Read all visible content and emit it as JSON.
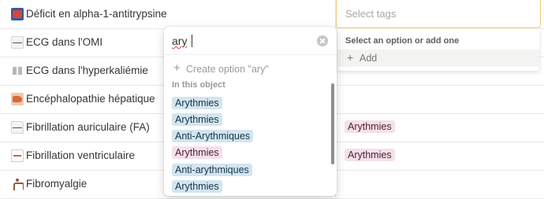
{
  "rows": [
    {
      "label": "Déficit en alpha-1-antitrypsine",
      "icon": "book-icon"
    },
    {
      "label": "ECG dans l'OMI",
      "icon": "ecg-icon"
    },
    {
      "label": "ECG dans l'hyperkaliémie",
      "icon": "ecg-pair-icon"
    },
    {
      "label": "Encéphalopathie hépatique",
      "icon": "liver-icon"
    },
    {
      "label": "Fibrillation auriculaire (FA)",
      "icon": "ecg-strip-icon",
      "tag": "Arythmies"
    },
    {
      "label": "Fibrillation ventriculaire",
      "icon": "ecg-grid-icon",
      "tag": "Arythmies"
    },
    {
      "label": "Fibromyalgie",
      "icon": "figure-icon"
    }
  ],
  "tags_cell": {
    "placeholder": "Select tags"
  },
  "option_menu": {
    "header": "Select an option or add one",
    "add_label": "Add"
  },
  "search_popup": {
    "query": "ary",
    "create_label": "Create option \"ary\"",
    "section_label": "In this object",
    "options": [
      {
        "label": "Arythmies",
        "color": "blue"
      },
      {
        "label": "Arythmies",
        "color": "blue"
      },
      {
        "label": "Anti-Arythmiques",
        "color": "blue"
      },
      {
        "label": "Arythmies",
        "color": "pink"
      },
      {
        "label": "Anti-arythmiques",
        "color": "blue"
      },
      {
        "label": "Arythmies",
        "color": "blue"
      }
    ]
  },
  "colors": {
    "accent_border": "#f1c879",
    "tag_blue": "#d3e5ef",
    "tag_pink": "#f5e0e9"
  }
}
